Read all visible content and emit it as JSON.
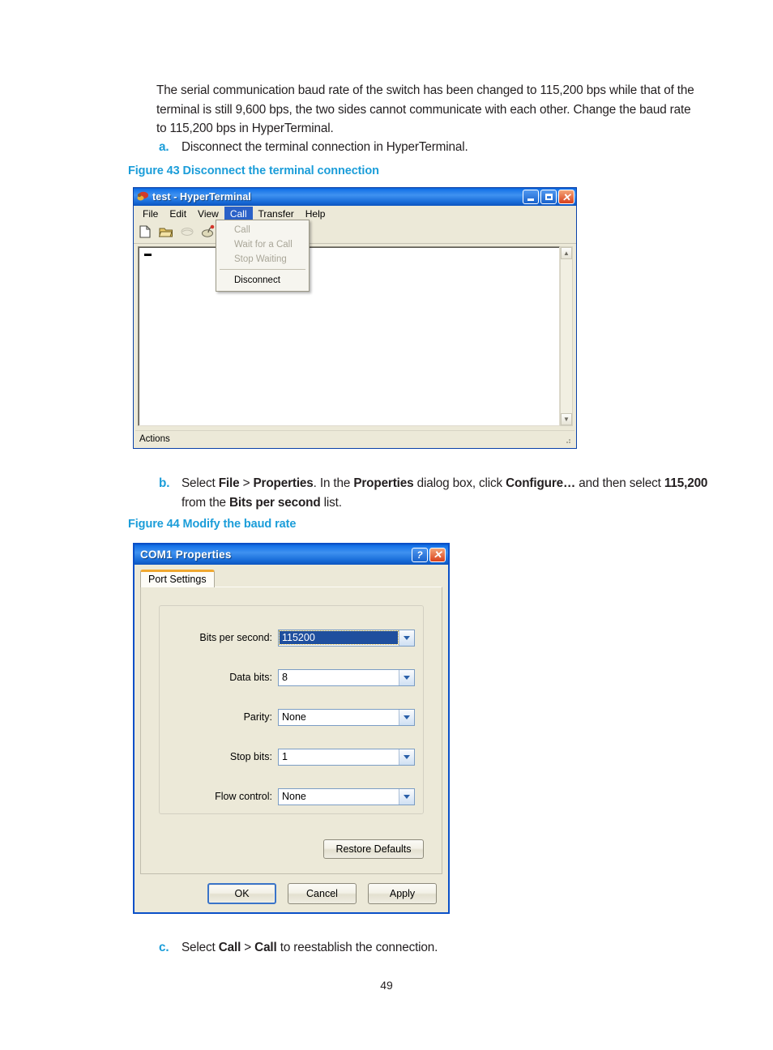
{
  "document": {
    "paragraph": "The serial communication baud rate of the switch has been changed to 115,200 bps while that of the terminal is still 9,600 bps, the two sides cannot communicate with each other. Change the baud rate to 115,200 bps in HyperTerminal.",
    "page_number": "49",
    "steps": {
      "a": {
        "marker": "a.",
        "text": "Disconnect the terminal connection in HyperTerminal."
      },
      "b": {
        "marker": "b.",
        "p1": "Select ",
        "b1": "File",
        "p2": " > ",
        "b2": "Properties",
        "p3": ". In the ",
        "b3": "Properties",
        "p4": " dialog box, click ",
        "b4": "Configure…",
        "p5": " and then select ",
        "b5": "115,200",
        "p6": " from the ",
        "b6": "Bits per second",
        "p7": " list."
      },
      "c": {
        "marker": "c.",
        "p1": "Select ",
        "b1": "Call",
        "p2": " > ",
        "b2": "Call",
        "p3": " to reestablish the connection."
      }
    },
    "captions": {
      "fig43": "Figure 43 Disconnect the terminal connection",
      "fig44": "Figure 44 Modify the baud rate"
    },
    "colors": {
      "caption_blue": "#1b9dd9",
      "body_text": "#231f20"
    }
  },
  "hyperterminal": {
    "title": "test  - HyperTerminal",
    "window_buttons": {
      "minimize": "_",
      "maximize": "□",
      "close": "×"
    },
    "menubar": [
      {
        "label": "File",
        "active": false
      },
      {
        "label": "Edit",
        "active": false
      },
      {
        "label": "View",
        "active": false
      },
      {
        "label": "Call",
        "active": true
      },
      {
        "label": "Transfer",
        "active": false
      },
      {
        "label": "Help",
        "active": false
      }
    ],
    "toolbar": [
      {
        "icon": "new-document-icon"
      },
      {
        "icon": "open-folder-icon"
      },
      {
        "icon": "disconnect-phone-icon"
      },
      {
        "icon": "connect-phone-icon"
      }
    ],
    "call_menu": [
      {
        "label": "Call",
        "disabled": true
      },
      {
        "label": "Wait for a Call",
        "disabled": true
      },
      {
        "label": "Stop Waiting",
        "disabled": true
      },
      {
        "label": "Disconnect",
        "disabled": false
      }
    ],
    "terminal_content": "",
    "status_text": "Actions"
  },
  "com_properties": {
    "title": "COM1 Properties",
    "window_buttons": {
      "help": "?",
      "close": "×"
    },
    "tabs": [
      {
        "label": "Port Settings",
        "selected": true
      }
    ],
    "fields": [
      {
        "label": "Bits per second:",
        "value": "115200",
        "selected": true
      },
      {
        "label": "Data bits:",
        "value": "8",
        "selected": false
      },
      {
        "label": "Parity:",
        "value": "None",
        "selected": false
      },
      {
        "label": "Stop bits:",
        "value": "1",
        "selected": false
      },
      {
        "label": "Flow control:",
        "value": "None",
        "selected": false
      }
    ],
    "restore_button": "Restore Defaults",
    "buttons": [
      {
        "label": "OK",
        "default": true
      },
      {
        "label": "Cancel",
        "default": false
      },
      {
        "label": "Apply",
        "default": false
      }
    ],
    "colors": {
      "selection_blue": "#1f4f9e",
      "titlebar_blue": "#1673e8",
      "tab_accent": "#f0a830"
    }
  }
}
